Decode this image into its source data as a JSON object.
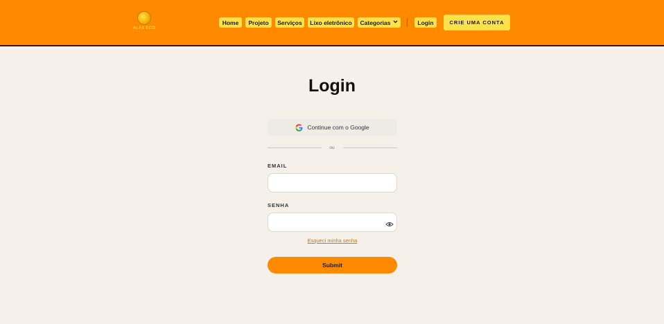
{
  "header": {
    "logo_text": "ALFA ECO",
    "nav": [
      {
        "label": "Home"
      },
      {
        "label": "Projeto"
      },
      {
        "label": "Serviços"
      },
      {
        "label": "Lixo eletrônico"
      },
      {
        "label": "Categorias",
        "icon": "chevron-down-icon"
      },
      {
        "label": "Login"
      }
    ],
    "cta_label": "CRIE UMA CONTA"
  },
  "colors": {
    "header_bg": "#ff8a00",
    "nav_button_bg": "#ffe14a",
    "page_bg": "#f5f1e8",
    "accent": "#ff8a00",
    "link": "#e07000"
  },
  "login": {
    "title": "Login",
    "google_label": "Continue com o Google",
    "google_icon": "google-g-icon",
    "divider_text": "ou",
    "email_label": "EMAIL",
    "email_value": "",
    "password_label": "SENHA",
    "password_value": "",
    "password_toggle_icon": "eye-icon",
    "forgot_label": "Esqueci minha senha",
    "submit_label": "Submit"
  }
}
